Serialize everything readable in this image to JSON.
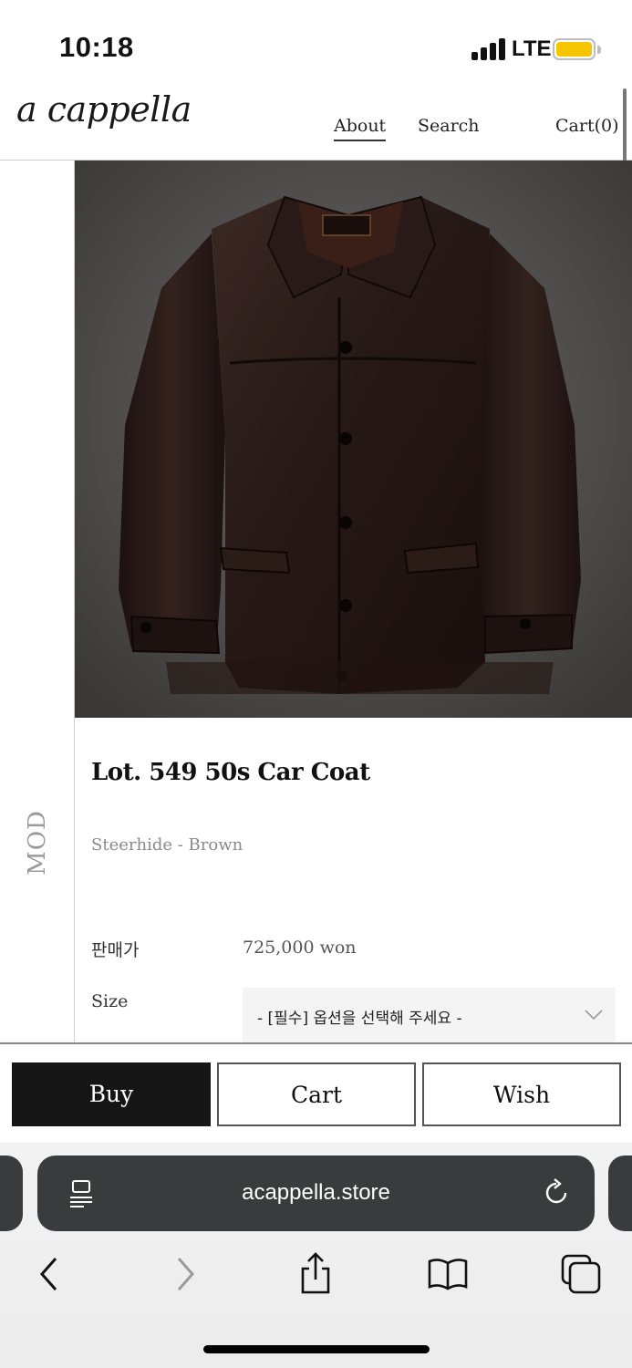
{
  "status_bar": {
    "time": "10:18",
    "carrier": "LTE",
    "battery_color": "#f7c400"
  },
  "header": {
    "logo": "a cappella",
    "nav": {
      "about": "About",
      "search": "Search",
      "cart": "Cart(0)"
    }
  },
  "side_rail": {
    "label": "MOD"
  },
  "product": {
    "image_alt": "brown leather car coat",
    "title": "Lot. 549 50s Car Coat",
    "subtitle": "Steerhide - Brown",
    "price_label": "판매가",
    "price_value": "725,000 won",
    "size_label": "Size",
    "size_select_value": "- [필수] 옵션을 선택해 주세요 -"
  },
  "actions": {
    "buy": "Buy",
    "cart": "Cart",
    "wish": "Wish",
    "buy_color": "#151515"
  },
  "browser": {
    "url": "acappella.store",
    "icons": [
      "reader-icon",
      "reload-icon",
      "back-icon",
      "forward-icon",
      "share-icon",
      "bookmarks-icon",
      "tabs-icon"
    ]
  }
}
